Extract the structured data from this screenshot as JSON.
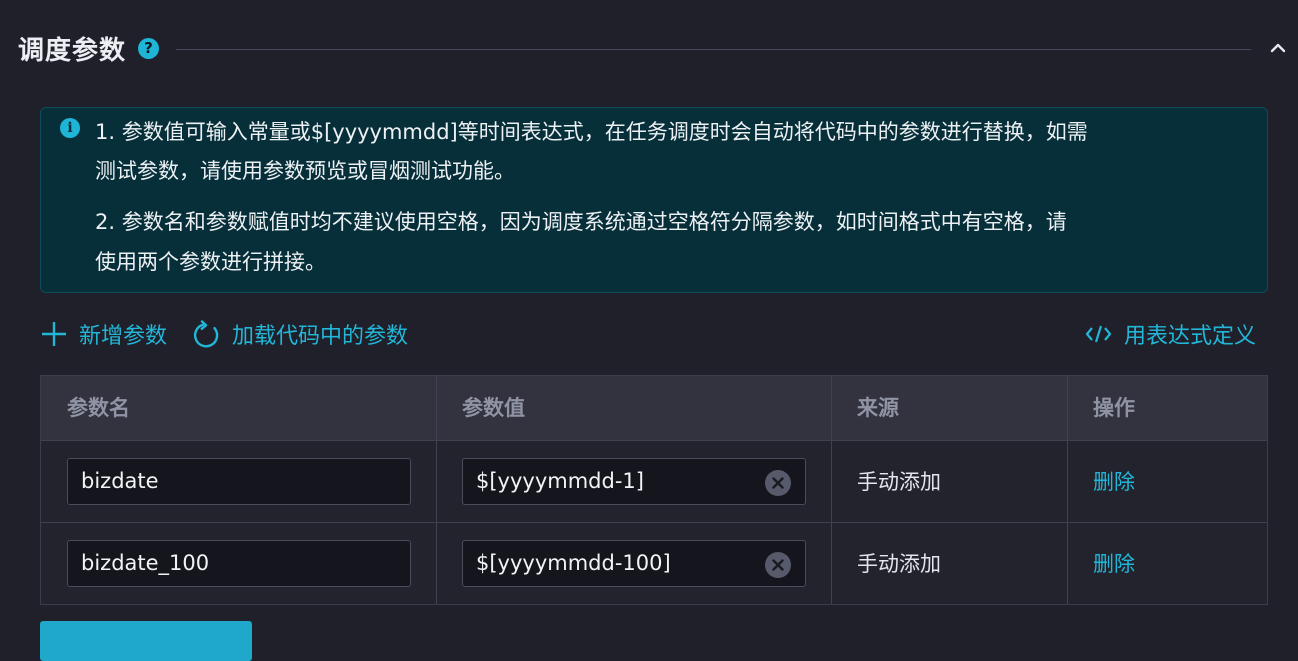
{
  "section": {
    "title": "调度参数",
    "help_icon": "?"
  },
  "info": {
    "icon": "i",
    "line1": "1. 参数值可输入常量或$[yyyymmdd]等时间表达式，在任务调度时会自动将代码中的参数进行替换，如需",
    "line2": "测试参数，请使用参数预览或冒烟测试功能。",
    "line3": "2. 参数名和参数赋值时均不建议使用空格，因为调度系统通过空格符分隔参数，如时间格式中有空格，请",
    "line4": "使用两个参数进行拼接。"
  },
  "toolbar": {
    "add_label": "新增参数",
    "load_label": "加载代码中的参数",
    "expression_label": "用表达式定义"
  },
  "table": {
    "headers": [
      "参数名",
      "参数值",
      "来源",
      "操作"
    ],
    "rows": [
      {
        "name": "bizdate",
        "value": "$[yyyymmdd-1]",
        "source": "手动添加",
        "action": "删除"
      },
      {
        "name": "bizdate_100",
        "value": "$[yyyymmdd-100]",
        "source": "手动添加",
        "action": "删除"
      }
    ]
  },
  "colors": {
    "accent": "#22b6d8",
    "background": "#1f2029",
    "info_background": "#072f3a"
  }
}
